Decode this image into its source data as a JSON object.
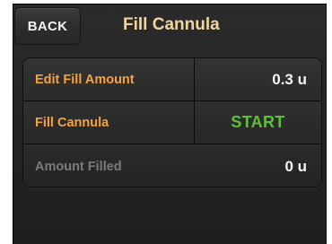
{
  "header": {
    "back_label": "BACK",
    "title": "Fill Cannula"
  },
  "rows": [
    {
      "label": "Edit Fill Amount",
      "value": "0.3 u"
    },
    {
      "label": "Fill Cannula",
      "value": "START"
    },
    {
      "label": "Amount Filled",
      "value": "0 u"
    }
  ],
  "colors": {
    "title": "#f2d59c",
    "label_active": "#f4a340",
    "label_disabled": "#7a7a7a",
    "start": "#5fbf3c",
    "value": "#f5f5f5"
  }
}
